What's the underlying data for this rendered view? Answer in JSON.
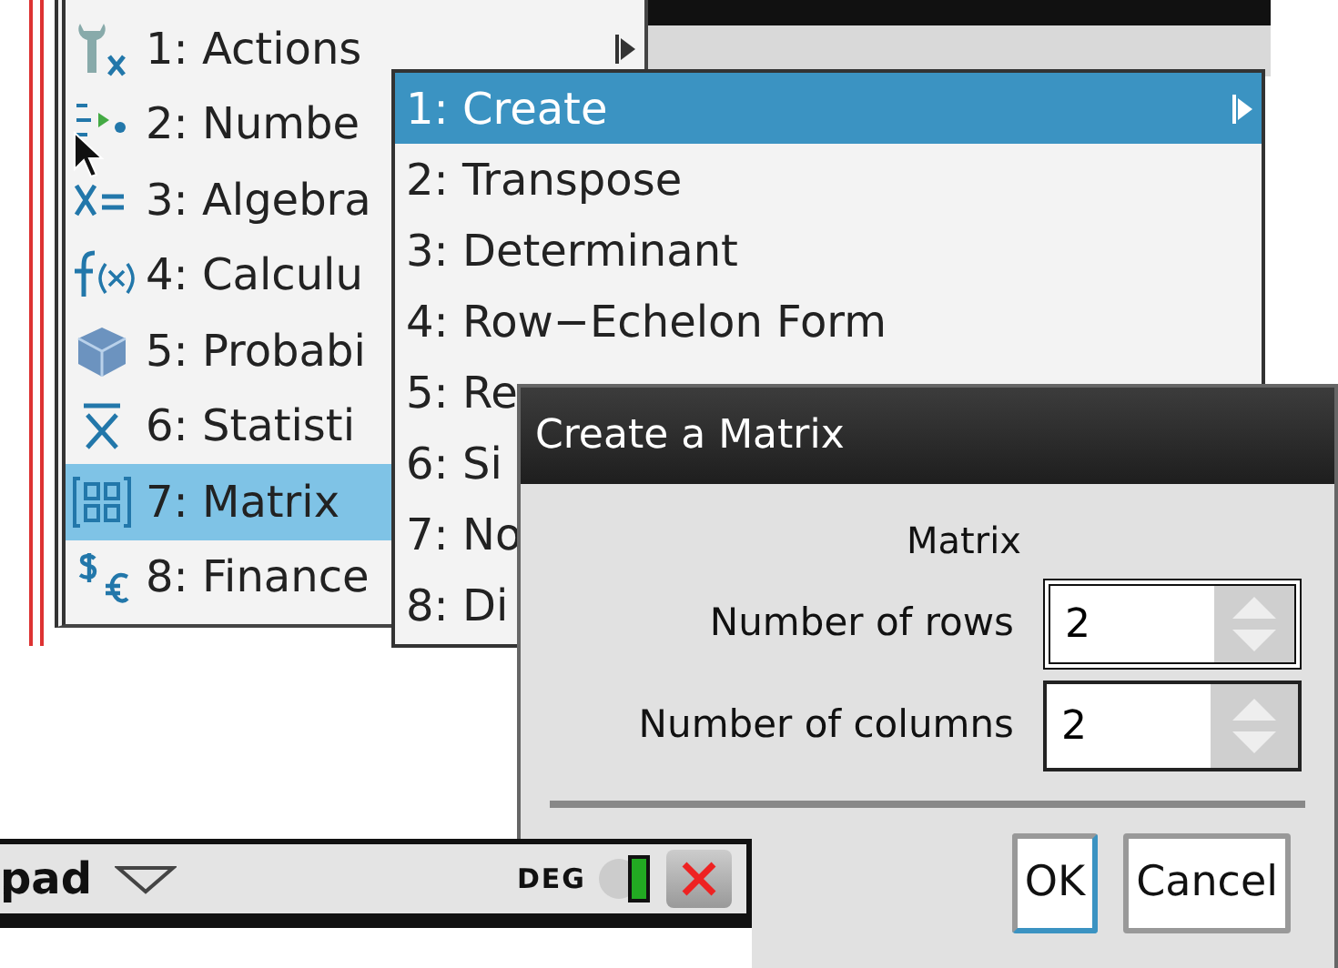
{
  "main_menu": {
    "items": [
      {
        "label": "1: Actions",
        "selected": false,
        "has_submenu": true
      },
      {
        "label": "2: Numbe",
        "selected": false
      },
      {
        "label": "3: Algebra",
        "selected": false
      },
      {
        "label": "4: Calculu",
        "selected": false
      },
      {
        "label": "5: Probabi",
        "selected": false
      },
      {
        "label": "6: Statisti",
        "selected": false
      },
      {
        "label": "7: Matrix",
        "selected": true
      },
      {
        "label": "8: Finance",
        "selected": false
      }
    ]
  },
  "submenu": {
    "items": [
      {
        "label": "1: Create",
        "selected": true,
        "has_submenu": true
      },
      {
        "label": "2: Transpose",
        "selected": false,
        "has_submenu": false
      },
      {
        "label": "3: Determinant",
        "selected": false,
        "has_submenu": false
      },
      {
        "label": "4: Row−Echelon Form",
        "selected": false,
        "has_submenu": false
      },
      {
        "label": "5: Re",
        "selected": false
      },
      {
        "label": "6: Si",
        "selected": false
      },
      {
        "label": "7: No",
        "selected": false
      },
      {
        "label": "8: Di",
        "selected": false
      }
    ]
  },
  "dialog": {
    "title": "Create a Matrix",
    "heading": "Matrix",
    "fields": [
      {
        "label": "Number of rows",
        "value": "2",
        "focused": true
      },
      {
        "label": "Number of columns",
        "value": "2",
        "focused": false
      }
    ],
    "buttons": [
      {
        "label": "OK",
        "default": true
      },
      {
        "label": "Cancel",
        "default": false
      }
    ]
  },
  "toolbar": {
    "title": "pad",
    "mode": "DEG"
  }
}
